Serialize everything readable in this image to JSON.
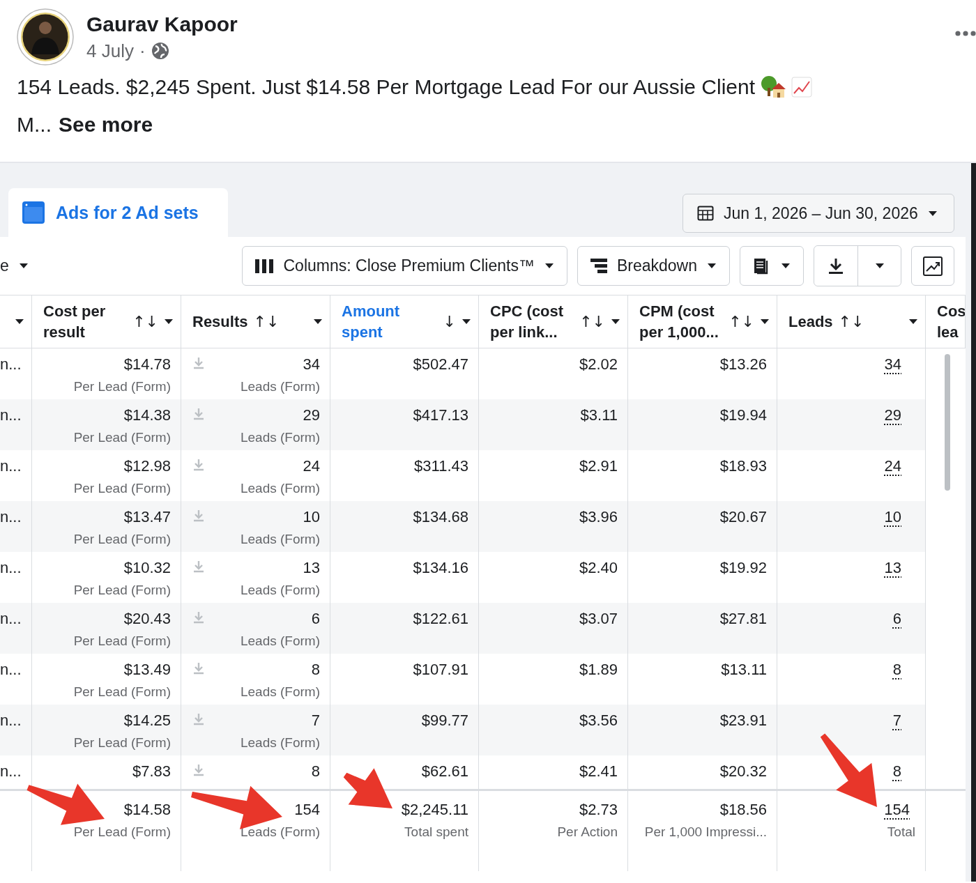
{
  "post": {
    "author": "Gaurav Kapoor",
    "date": "4 July",
    "separator": "·",
    "text": "154 Leads. $2,245 Spent. Just $14.58 Per Mortgage Lead For our Aussie Client",
    "text_more": "M...",
    "see_more": "See more"
  },
  "report": {
    "tab": {
      "label": "Ads for 2 Ad sets",
      "selected": true
    },
    "date_range": "Jun 1, 2026 – Jun 30, 2026",
    "toolbar": {
      "left_partial": "e",
      "columns_button": "Columns: Close Premium Clients™",
      "breakdown_button": "Breakdown"
    },
    "table": {
      "columns": [
        {
          "kind": "name"
        },
        {
          "kind": "aligned",
          "label": "Cost per result",
          "sort": "↑↓",
          "selected": false
        },
        {
          "kind": "inline",
          "label": "Results",
          "sort": "↑↓",
          "selected": false
        },
        {
          "kind": "aligned",
          "label": "Amount spent",
          "sort": "↓",
          "selected": true
        },
        {
          "kind": "aligned",
          "label": "CPC (cost per link...",
          "sort": "↑↓",
          "selected": false
        },
        {
          "kind": "aligned",
          "label": "CPM (cost per 1,000...",
          "sort": "↑↓",
          "selected": false
        },
        {
          "kind": "inline",
          "label": "Leads",
          "sort": "↑↓",
          "selected": false
        },
        {
          "kind": "aligned",
          "label": "Cos lea",
          "selected": false
        }
      ],
      "rows": [
        {
          "name": "n...",
          "cost": "$14.78",
          "cost_sub": "Per Lead (Form)",
          "results": "34",
          "results_sub": "Leads (Form)",
          "amount": "$502.47",
          "cpc": "$2.02",
          "cpm": "$13.26",
          "leads": "34"
        },
        {
          "name": "n...",
          "cost": "$14.38",
          "cost_sub": "Per Lead (Form)",
          "results": "29",
          "results_sub": "Leads (Form)",
          "amount": "$417.13",
          "cpc": "$3.11",
          "cpm": "$19.94",
          "leads": "29"
        },
        {
          "name": "n...",
          "cost": "$12.98",
          "cost_sub": "Per Lead (Form)",
          "results": "24",
          "results_sub": "Leads (Form)",
          "amount": "$311.43",
          "cpc": "$2.91",
          "cpm": "$18.93",
          "leads": "24"
        },
        {
          "name": "n...",
          "cost": "$13.47",
          "cost_sub": "Per Lead (Form)",
          "results": "10",
          "results_sub": "Leads (Form)",
          "amount": "$134.68",
          "cpc": "$3.96",
          "cpm": "$20.67",
          "leads": "10"
        },
        {
          "name": "n...",
          "cost": "$10.32",
          "cost_sub": "Per Lead (Form)",
          "results": "13",
          "results_sub": "Leads (Form)",
          "amount": "$134.16",
          "cpc": "$2.40",
          "cpm": "$19.92",
          "leads": "13"
        },
        {
          "name": "n...",
          "cost": "$20.43",
          "cost_sub": "Per Lead (Form)",
          "results": "6",
          "results_sub": "Leads (Form)",
          "amount": "$122.61",
          "cpc": "$3.07",
          "cpm": "$27.81",
          "leads": "6"
        },
        {
          "name": "n...",
          "cost": "$13.49",
          "cost_sub": "Per Lead (Form)",
          "results": "8",
          "results_sub": "Leads (Form)",
          "amount": "$107.91",
          "cpc": "$1.89",
          "cpm": "$13.11",
          "leads": "8"
        },
        {
          "name": "n...",
          "cost": "$14.25",
          "cost_sub": "Per Lead (Form)",
          "results": "7",
          "results_sub": "Leads (Form)",
          "amount": "$99.77",
          "cpc": "$3.56",
          "cpm": "$23.91",
          "leads": "7"
        },
        {
          "name": "n...",
          "cost": "$7.83",
          "results": "8",
          "amount": "$62.61",
          "cpc": "$2.41",
          "cpm": "$20.32",
          "leads": "8"
        }
      ],
      "totals": {
        "cost": "$14.58",
        "cost_sub": "Per Lead (Form)",
        "results": "154",
        "results_sub": "Leads (Form)",
        "amount": "$2,245.11",
        "amount_sub": "Total spent",
        "cpc": "$2.73",
        "cpc_sub": "Per Action",
        "cpm": "$18.56",
        "cpm_sub": "Per 1,000 Impressi...",
        "leads": "154",
        "leads_sub": "Total"
      }
    }
  }
}
